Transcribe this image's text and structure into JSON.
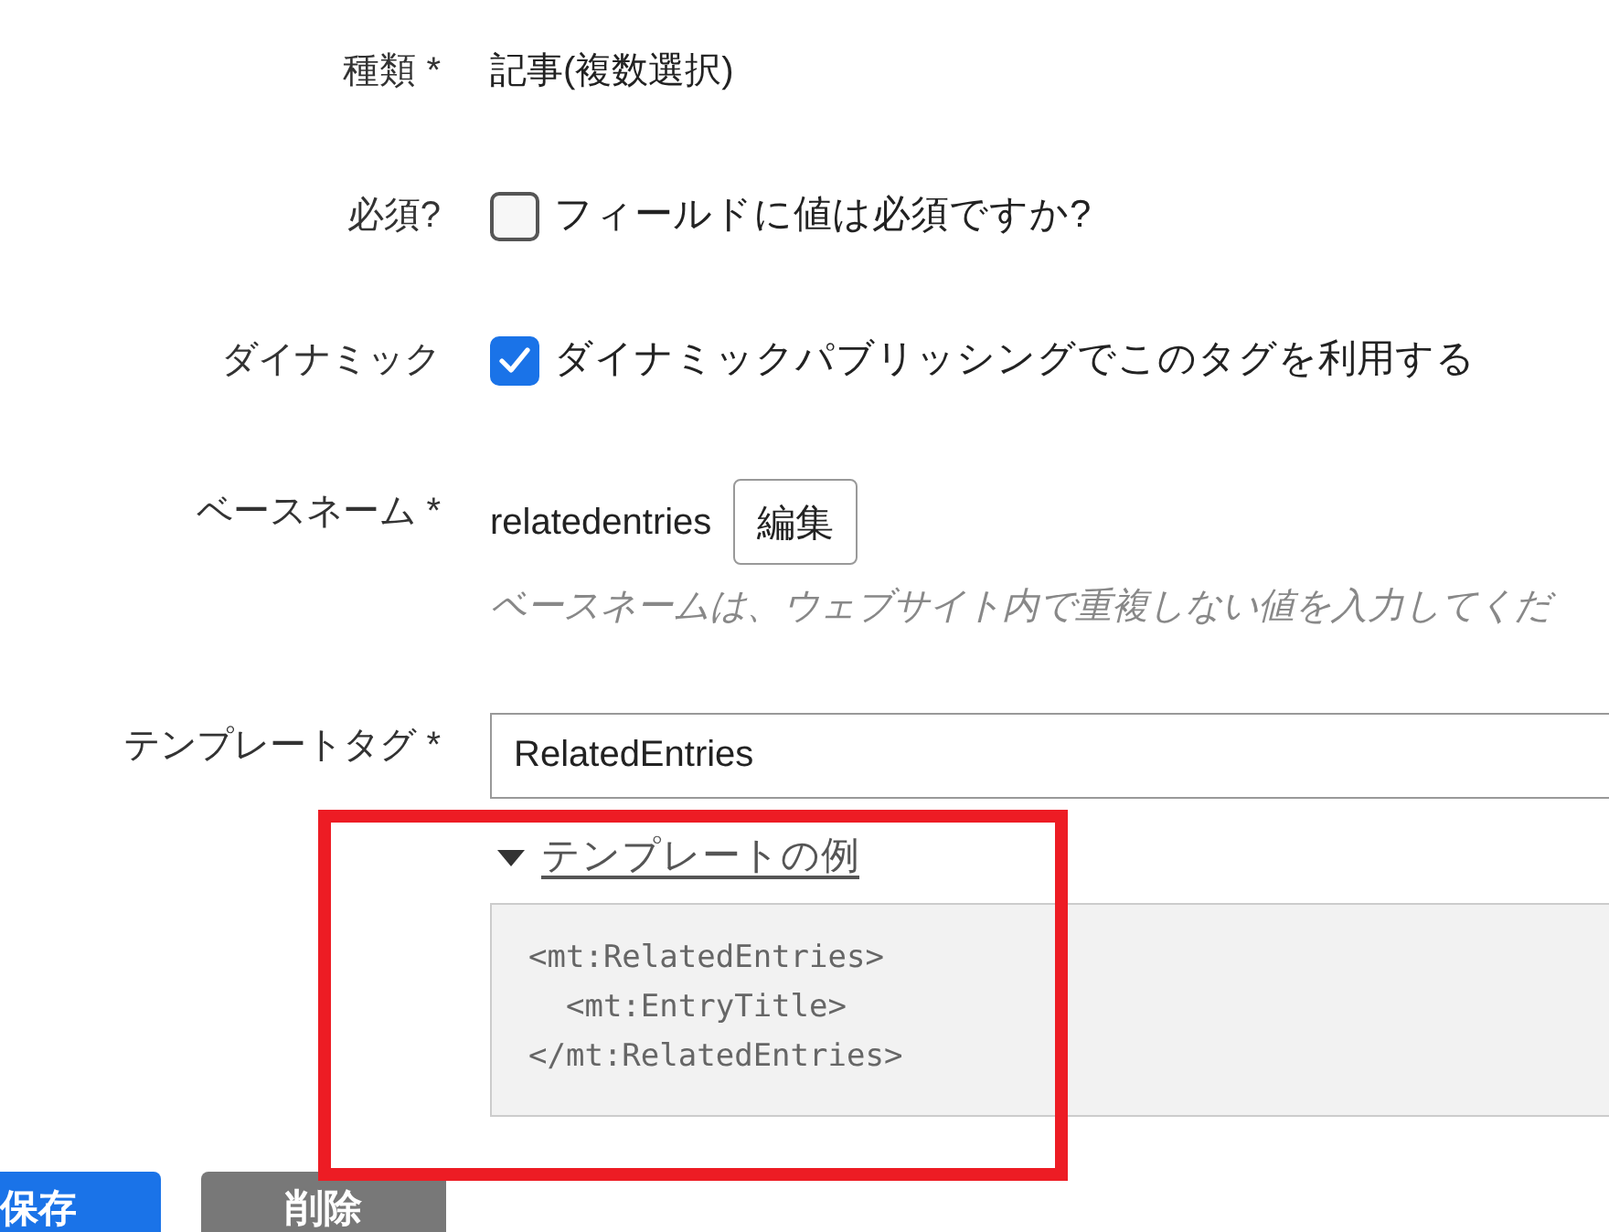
{
  "fields": [
    {
      "kind": "text",
      "label": "種類 *",
      "value": "記事(複数選択)"
    },
    {
      "kind": "checkbox",
      "label": "必須?",
      "checked": false,
      "text": "フィールドに値は必須ですか?"
    },
    {
      "kind": "checkbox",
      "label": "ダイナミック",
      "checked": true,
      "text": "ダイナミックパブリッシングでこのタグを利用する"
    },
    {
      "kind": "basename",
      "label": "ベースネーム *",
      "value": "relatedentries",
      "button": "編集",
      "hint": "ベースネームは、ウェブサイト内で重複しない値を入力してくだ"
    },
    {
      "kind": "input",
      "label": "テンプレートタグ *",
      "value": "RelatedEntries",
      "example": {
        "expanded": true,
        "toggle": "テンプレートの例",
        "code": [
          "<mt:RelatedEntries>",
          "  <mt:EntryTitle>",
          "</mt:RelatedEntries>"
        ]
      }
    }
  ],
  "buttons": [
    {
      "kind": "primary",
      "label": "保存"
    },
    {
      "kind": "secondary",
      "label": "削除"
    }
  ]
}
